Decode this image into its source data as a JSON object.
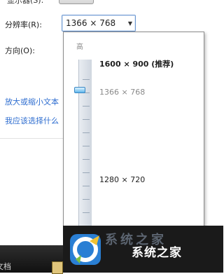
{
  "top": {
    "partial_label": "显示器(S):"
  },
  "settings": {
    "resolution_label": "分辨率(R):",
    "resolution_value": "1366 × 768",
    "orientation_label": "方向(O):"
  },
  "links": {
    "enlarge_text": "放大或缩小文本",
    "which_settings": "我应该选择什么"
  },
  "popup": {
    "high_label": "高",
    "options": [
      {
        "label": "1600 × 900 (推荐)",
        "bold": true
      },
      {
        "label": "1366 × 768",
        "dimmed": true
      },
      {
        "label": "1280 × 720"
      }
    ],
    "selected_index": 1
  },
  "taskbar": {
    "text": "文档"
  },
  "watermark": {
    "title": "系统之家",
    "faint_text": "系统之家"
  },
  "icons": [
    "chevron-down-icon",
    "slider-thumb",
    "xitongzhijia-logo"
  ],
  "colors": {
    "link": "#2f6ed0",
    "combo_border": "#6a96d0",
    "thumb": "#5fb6ea"
  }
}
